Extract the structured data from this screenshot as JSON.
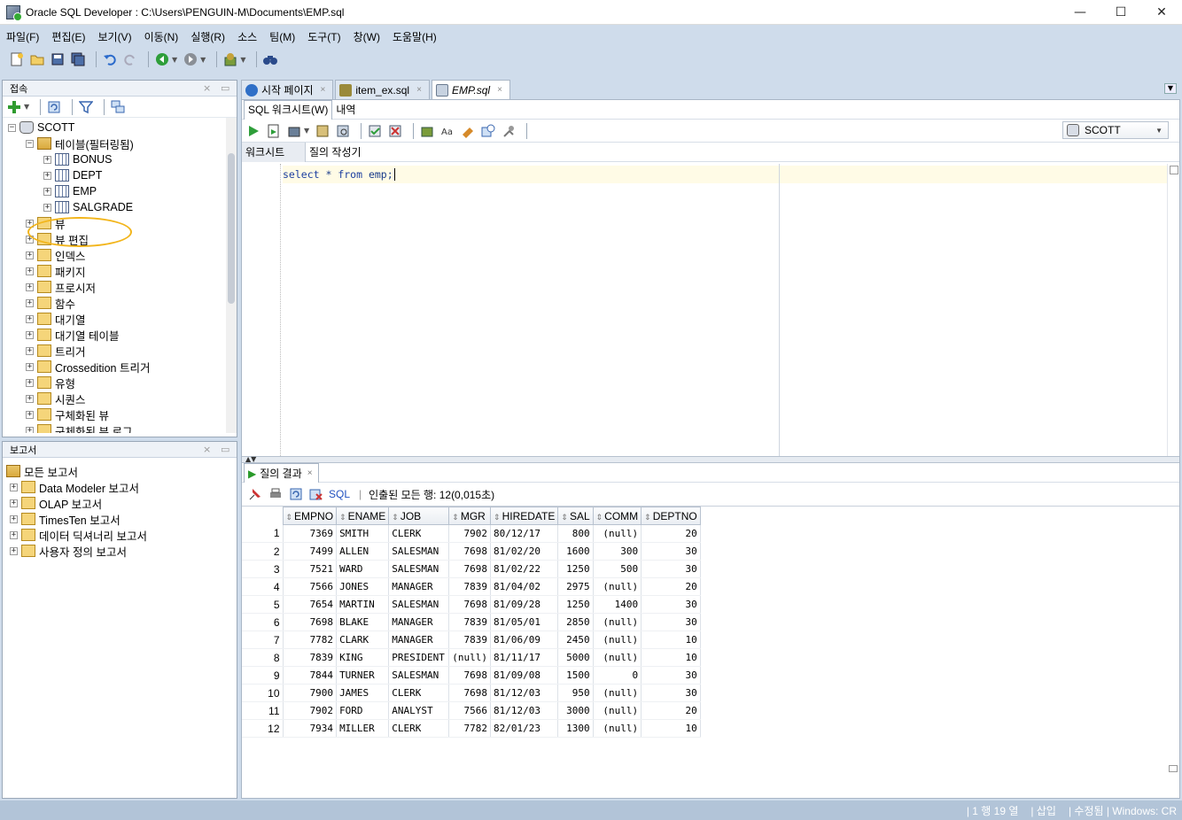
{
  "window": {
    "title": "Oracle SQL Developer : C:\\Users\\PENGUIN-M\\Documents\\EMP.sql",
    "minimize": "—",
    "maximize": "☐",
    "close": "✕"
  },
  "menu": [
    "파일(F)",
    "편집(E)",
    "보기(V)",
    "이동(N)",
    "실행(R)",
    "소스",
    "팀(M)",
    "도구(T)",
    "창(W)",
    "도움말(H)"
  ],
  "connections_panel": {
    "title": "접속",
    "close": "×",
    "min": "▭"
  },
  "tree": {
    "root": "SCOTT",
    "tables_folder": "테이블(필터링됨)",
    "tables": [
      "BONUS",
      "DEPT",
      "EMP",
      "SALGRADE"
    ],
    "folders": [
      "뷰",
      "뷰 편집",
      "인덱스",
      "패키지",
      "프로시저",
      "함수",
      "대기열",
      "대기열 테이블",
      "트리거",
      "Crossedition 트리거",
      "유형",
      "시퀀스",
      "구체화된 뷰",
      "구체화된 뷰 로그"
    ]
  },
  "reports_panel": {
    "title": "보고서",
    "close": "×",
    "min": "▭",
    "root": "모든 보고서",
    "items": [
      "Data Modeler 보고서",
      "OLAP 보고서",
      "TimesTen 보고서",
      "데이터 딕셔너리 보고서",
      "사용자 정의 보고서"
    ]
  },
  "editor_tabs": [
    {
      "label": "시작 페이지",
      "close": "×"
    },
    {
      "label": "item_ex.sql",
      "close": "×"
    },
    {
      "label": "EMP.sql",
      "close": "×"
    }
  ],
  "subtabs": [
    "SQL 워크시트(W)",
    "내역"
  ],
  "connection_selector": {
    "value": "SCOTT"
  },
  "inner_tabs": [
    "워크시트",
    "질의 작성기"
  ],
  "sql": {
    "select": "select",
    "star": " * ",
    "from": "from",
    "rest": " emp;"
  },
  "results": {
    "tab_label": "질의 결과",
    "tab_close": "×",
    "sql_link": "SQL",
    "status": "인출된 모든 행: 12(0,015초)",
    "columns": [
      "EMPNO",
      "ENAME",
      "JOB",
      "MGR",
      "HIREDATE",
      "SAL",
      "COMM",
      "DEPTNO"
    ],
    "rows": [
      [
        "1",
        "7369",
        "SMITH",
        "CLERK",
        "7902",
        "80/12/17",
        "800",
        "(null)",
        "20"
      ],
      [
        "2",
        "7499",
        "ALLEN",
        "SALESMAN",
        "7698",
        "81/02/20",
        "1600",
        "300",
        "30"
      ],
      [
        "3",
        "7521",
        "WARD",
        "SALESMAN",
        "7698",
        "81/02/22",
        "1250",
        "500",
        "30"
      ],
      [
        "4",
        "7566",
        "JONES",
        "MANAGER",
        "7839",
        "81/04/02",
        "2975",
        "(null)",
        "20"
      ],
      [
        "5",
        "7654",
        "MARTIN",
        "SALESMAN",
        "7698",
        "81/09/28",
        "1250",
        "1400",
        "30"
      ],
      [
        "6",
        "7698",
        "BLAKE",
        "MANAGER",
        "7839",
        "81/05/01",
        "2850",
        "(null)",
        "30"
      ],
      [
        "7",
        "7782",
        "CLARK",
        "MANAGER",
        "7839",
        "81/06/09",
        "2450",
        "(null)",
        "10"
      ],
      [
        "8",
        "7839",
        "KING",
        "PRESIDENT",
        "(null)",
        "81/11/17",
        "5000",
        "(null)",
        "10"
      ],
      [
        "9",
        "7844",
        "TURNER",
        "SALESMAN",
        "7698",
        "81/09/08",
        "1500",
        "0",
        "30"
      ],
      [
        "10",
        "7900",
        "JAMES",
        "CLERK",
        "7698",
        "81/12/03",
        "950",
        "(null)",
        "30"
      ],
      [
        "11",
        "7902",
        "FORD",
        "ANALYST",
        "7566",
        "81/12/03",
        "3000",
        "(null)",
        "20"
      ],
      [
        "12",
        "7934",
        "MILLER",
        "CLERK",
        "7782",
        "82/01/23",
        "1300",
        "(null)",
        "10"
      ]
    ]
  },
  "statusbar": {
    "position": "| 1 행 19 열",
    "mode": "| 삽입",
    "modified": "| 수정됨 | Windows: CR"
  },
  "colors": {
    "highlight": "#f2b51c",
    "statusbar": "#b2c4d8",
    "background": "#cfdceb"
  }
}
